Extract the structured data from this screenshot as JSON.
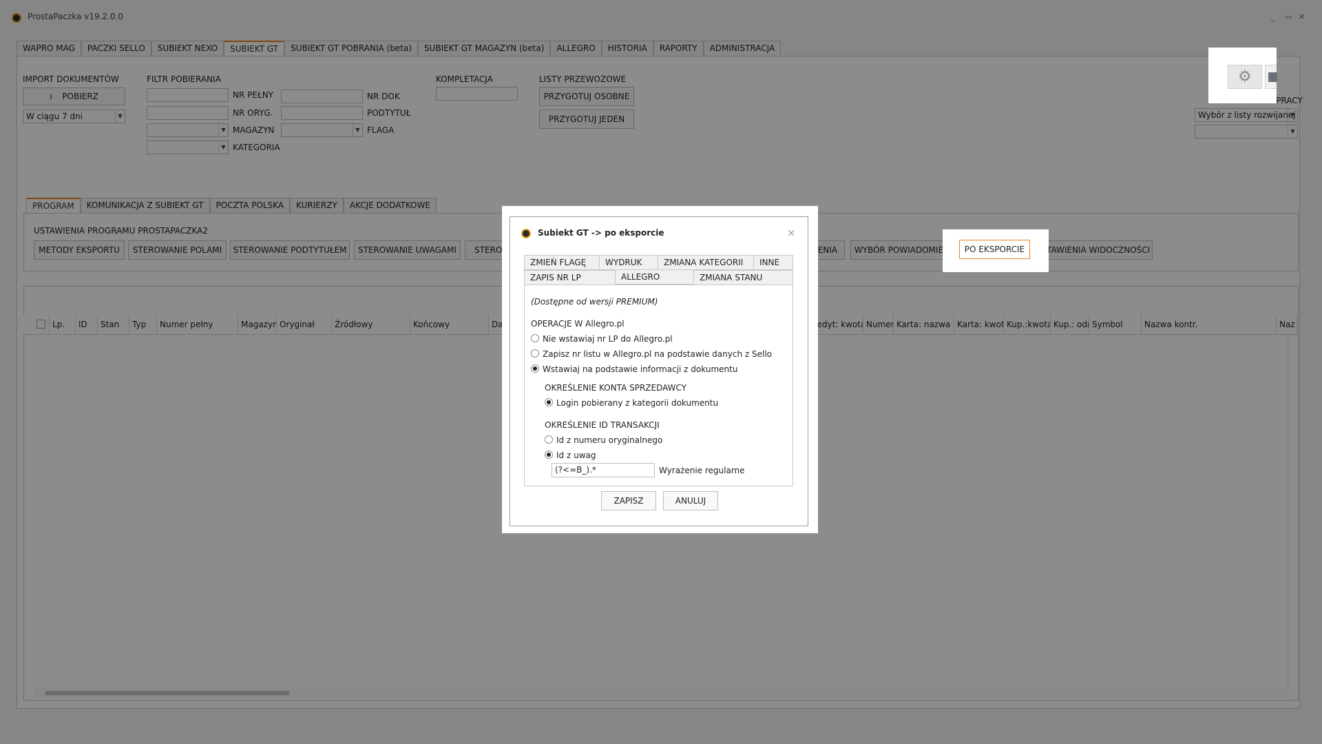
{
  "app": {
    "title": "ProstaPaczka v19.2.0.0",
    "minimize": "_",
    "restore": "▭",
    "close": "✕"
  },
  "main_tabs": [
    "WAPRO MAG",
    "PACZKI SELLO",
    "SUBIEKT NEXO",
    "SUBIEKT GT",
    "SUBIEKT GT POBRANIA (beta)",
    "SUBIEKT GT MAGAZYN (beta)",
    "ALLEGRO",
    "HISTORIA",
    "RAPORTY",
    "ADMINISTRACJA"
  ],
  "import": {
    "title": "IMPORT DOKUMENTÓW",
    "fetch_button": "POBIERZ",
    "range_value": "W ciągu 7 dni"
  },
  "filter": {
    "title": "FILTR POBIERANIA",
    "nr_pelny": "NR PEŁNY",
    "nr_oryg": "NR ORYG.",
    "magazyn": "MAGAZYN",
    "kategoria": "KATEGORIA",
    "nr_dok": "NR DOK",
    "podtytul": "PODTYTUŁ",
    "flaga": "FLAGA"
  },
  "kompletacja": {
    "title": "KOMPLETACJA"
  },
  "listy": {
    "title": "LISTY PRZEWOZOWE",
    "separate_button": "PRZYGOTUJ OSOBNE",
    "single_button": "PRZYGOTUJ JEDEN"
  },
  "work_mode": {
    "title": "TRYB PRACY",
    "select_value": "Wybór z listy rozwijanej",
    "second_value": ""
  },
  "sub_tabs": [
    "PROGRAM",
    "KOMUNIKACJA Z SUBIEKT GT",
    "POCZTA POLSKA",
    "KURIERZY",
    "AKCJE DODATKOWE"
  ],
  "settings": {
    "title": "USTAWIENIA PROGRAMU PROSTAPACZKA2",
    "buttons_left": [
      "METODY EKSPORTU",
      "STEROWANIE POLAMI",
      "STEROWANIE PODTYTUŁEM",
      "STEROWANIE UWAGAMI",
      "STEROWA"
    ],
    "buttons_right": [
      "OWIENIA",
      "WYBÓR POWIADOMIEŃ",
      "PO EKSPORCIE",
      "USTAWIENIA WIDOCZNOŚCI"
    ]
  },
  "grid": {
    "columns_left": [
      "Lp.",
      "ID",
      "Stan",
      "Typ",
      "Numer pełny",
      "Magazyn",
      "Oryginał",
      "Źródłowy",
      "Końcowy",
      "Data"
    ],
    "columns_right": [
      "Kredyt: kwota",
      "Numer",
      "Karta: nazwa",
      "Karta: kwota",
      "Kup.:kwota",
      "Kup.: odr",
      "Symbol",
      "Nazwa kontr.",
      "Naz"
    ]
  },
  "dialog": {
    "title": "Subiekt GT -> po eksporcie",
    "close": "×",
    "tabs_row1": [
      "ZMIEŃ FLAGĘ",
      "WYDRUK",
      "ZMIANA KATEGORII",
      "INNE"
    ],
    "tabs_row2": [
      "ZAPIS NR LP",
      "ALLEGRO",
      "ZMIANA STANU"
    ],
    "premium_note": "(Dostępne od wersji PREMIUM)",
    "operations_title": "OPERACJE W Allegro.pl",
    "options": [
      "Nie wstawiaj nr LP do Allegro.pl",
      "Zapisz nr listu w Allegro.pl na podstawie danych z Sello",
      "Wstawiaj na podstawie informacji z dokumentu"
    ],
    "selected_option": 2,
    "seller_title": "OKREŚLENIE KONTA SPRZEDAWCY",
    "seller_option": "Login pobierany z kategorii dokumentu",
    "trans_title": "OKREŚLENIE ID TRANSAKCJI",
    "trans_options": [
      "Id z numeru oryginalnego",
      "Id z uwag"
    ],
    "trans_selected": 1,
    "regex_value": "(?<=B_).*",
    "regex_label": "Wyrażenie regularne",
    "save_button": "ZAPISZ",
    "cancel_button": "ANULUJ"
  },
  "colors": {
    "accent": "#e8821c",
    "overlay": "rgba(0,0,0,0.45)"
  }
}
